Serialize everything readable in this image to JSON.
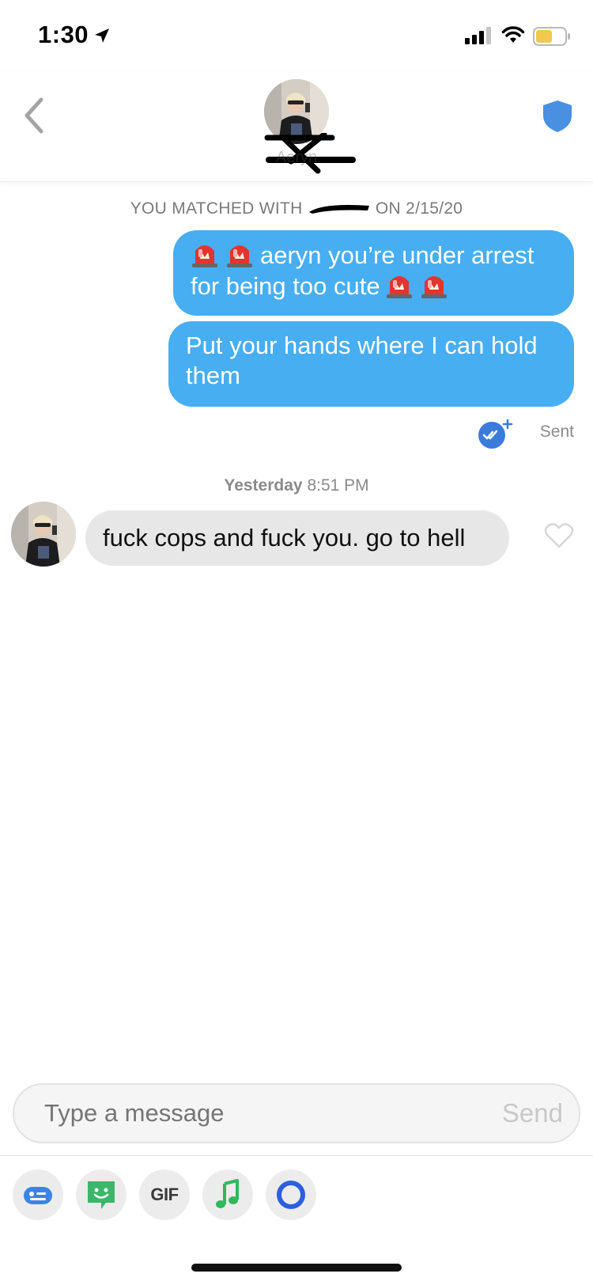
{
  "status_bar": {
    "time": "1:30",
    "icons": [
      "location-arrow-icon",
      "cellular-signal-icon",
      "wifi-icon",
      "battery-icon"
    ],
    "battery_color": "#f2c94c"
  },
  "header": {
    "profile_name": "Aeryn",
    "icons": [
      "chevron-left-icon",
      "shield-icon"
    ],
    "accent": "#4a90e2"
  },
  "conversation": {
    "match_banner_prefix": "YOU MATCHED WITH",
    "match_banner_suffix": "ON 2/15/20",
    "outgoing": [
      {
        "text": "aeryn you’re under arrest for being too cute",
        "emoji": "siren"
      },
      {
        "text": "Put your hands where I can hold them"
      }
    ],
    "status": "Sent",
    "timestamp_day": "Yesterday",
    "timestamp_time": "8:51 PM",
    "incoming": [
      {
        "text": "fuck cops and fuck you. go to hell"
      }
    ],
    "bubble_out_color": "#47aef2",
    "bubble_in_color": "#e7e7e7"
  },
  "composer": {
    "placeholder": "Type a message",
    "send_label": "Send"
  },
  "toolbar": {
    "gif_label": "GIF",
    "tools": [
      "bitmoji-card-icon",
      "sticker-icon",
      "gif-icon",
      "music-note-icon",
      "loop-icon"
    ]
  }
}
